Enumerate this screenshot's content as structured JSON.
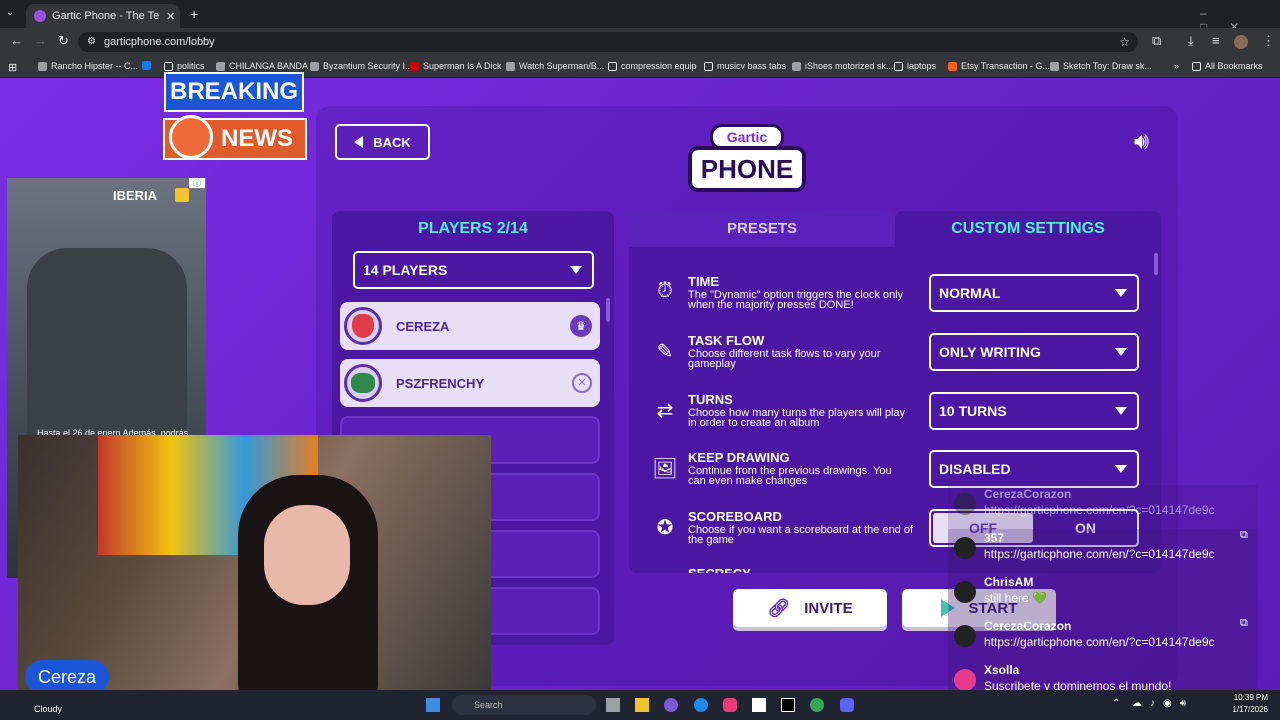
{
  "browser": {
    "tab_title": "Gartic Phone - The Telephone G",
    "url": "garticphone.com/lobby",
    "bookmarks": [
      "Rancho Hipster -- C...",
      "politics",
      "CHILANGA BANDA",
      "Byzantium Security I...",
      "Superman Is A Dick",
      "Watch Superman/B...",
      "compression equip",
      "musicv bass tabs",
      "iShoes motorized sk...",
      "laptops",
      "Etsy Transaction - G...",
      "Sketch Toy: Draw sk..."
    ],
    "all_bookmarks": "All Bookmarks"
  },
  "overlay": {
    "breaking": "BREAKING",
    "news": "NEWS",
    "ad_brand": "IBERIA",
    "ad_caption": "Hasta el 26 de enero Además, podrás",
    "streamer_name": "Cereza"
  },
  "game": {
    "back_label": "BACK",
    "logo_top": "Gartic",
    "logo_bottom": "PHONE",
    "players_header": "PLAYERS 2/14",
    "players_select": "14 PLAYERS",
    "players": [
      {
        "name": "CEREZA",
        "badge": "crown"
      },
      {
        "name": "PSZFRENCHY",
        "badge": "remove"
      }
    ],
    "tab_presets": "PRESETS",
    "tab_custom": "CUSTOM SETTINGS",
    "settings": [
      {
        "name": "TIME",
        "desc": "The \"Dynamic\" option triggers the clock only when the majority presses DONE!",
        "value": "NORMAL",
        "icon": "alarm-icon"
      },
      {
        "name": "TASK FLOW",
        "desc": "Choose different task flows to vary your gameplay",
        "value": "ONLY WRITING",
        "icon": "flow-icon"
      },
      {
        "name": "TURNS",
        "desc": "Choose how many turns the players will play in order to create an album",
        "value": "10 TURNS",
        "icon": "turns-icon"
      },
      {
        "name": "KEEP DRAWING",
        "desc": "Continue from the previous drawings. You can even make changes",
        "value": "DISABLED",
        "icon": "drawing-icon"
      },
      {
        "name": "SCOREBOARD",
        "desc": "Choose if you want a scoreboard at the end of the game",
        "icon": "medal-icon"
      }
    ],
    "toggle_off": "OFF",
    "toggle_on": "ON",
    "secrecy": "SECRECY",
    "invite_label": "INVITE",
    "start_label": "START"
  },
  "chat": [
    {
      "user": "CerezaCorazon",
      "msg": "https://garticphone.com/en/?c=014147de9c"
    },
    {
      "user": "357",
      "msg": "https://garticphone.com/en/?c=014147de9c"
    },
    {
      "user": "ChrisAM",
      "msg": "still here 💚"
    },
    {
      "user": "CerezaCorazon",
      "msg": "https://garticphone.com/en/?c=014147de9c"
    },
    {
      "user": "Xsolla",
      "msg": "Suscribete y dominemos el mundo!"
    }
  ],
  "taskbar": {
    "weather": "Cloudy",
    "search_placeholder": "Search",
    "time": "10:39 PM",
    "date": "1/17/2026"
  }
}
